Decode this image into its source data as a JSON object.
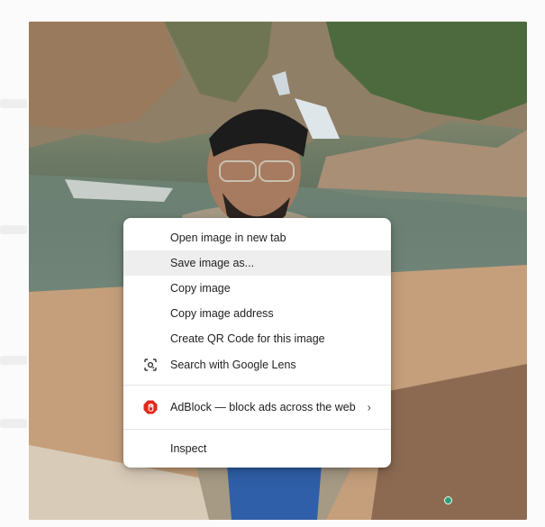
{
  "context_menu": {
    "items": [
      {
        "label": "Open image in new tab"
      },
      {
        "label": "Save image as..."
      },
      {
        "label": "Copy image"
      },
      {
        "label": "Copy image address"
      },
      {
        "label": "Create QR Code for this image"
      },
      {
        "label": "Search with Google Lens",
        "icon": "google-lens-icon"
      },
      {
        "label": "AdBlock — block ads across the web",
        "icon": "adblock-icon",
        "has_submenu": true
      },
      {
        "label": "Inspect"
      }
    ],
    "highlighted_item": "Save image as..."
  },
  "colors": {
    "menu_bg": "#ffffff",
    "hover_bg": "#eeeeee",
    "adblock_red": "#e3261b",
    "status_dot": "#2f9e78"
  }
}
